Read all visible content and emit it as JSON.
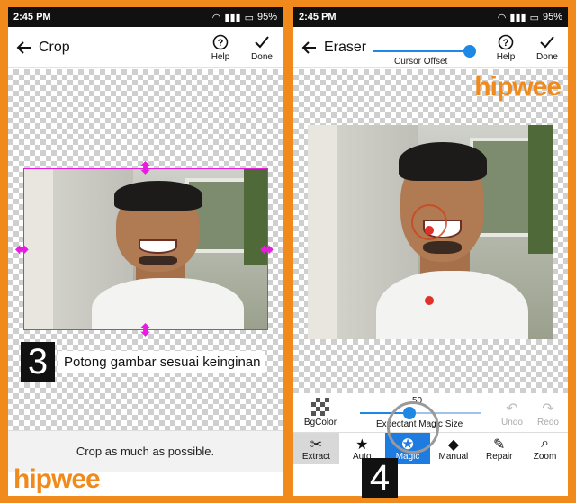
{
  "left": {
    "status": {
      "time": "2:45 PM",
      "battery": "95%"
    },
    "toolbar": {
      "title": "Crop",
      "help": "Help",
      "done": "Done"
    },
    "step": {
      "number": "3",
      "text": "Potong gambar sesuai keinginan"
    },
    "bottom_message": "Crop as much as possible.",
    "brand": "hipwee"
  },
  "right": {
    "status": {
      "time": "2:45 PM",
      "battery": "95%"
    },
    "toolbar": {
      "title": "Eraser",
      "cursor_offset_label": "Cursor Offset",
      "help": "Help",
      "done": "Done"
    },
    "brand": "hipwee",
    "tools": {
      "bgcolor": "BgColor",
      "magic_size_label": "Expectant Magic Size",
      "magic_size_value": "50",
      "undo": "Undo",
      "redo": "Redo"
    },
    "tabs": [
      {
        "label": "Extract",
        "icon": "scissors-icon"
      },
      {
        "label": "Auto",
        "icon": "star-icon"
      },
      {
        "label": "Magic",
        "icon": "magic-icon"
      },
      {
        "label": "Manual",
        "icon": "eraser-icon"
      },
      {
        "label": "Repair",
        "icon": "brush-icon"
      },
      {
        "label": "Zoom",
        "icon": "zoom-icon"
      }
    ],
    "step": {
      "number": "4"
    }
  },
  "colors": {
    "frame": "#f08a1c",
    "accent": "#1e88e5",
    "crop": "#e81ce0"
  }
}
